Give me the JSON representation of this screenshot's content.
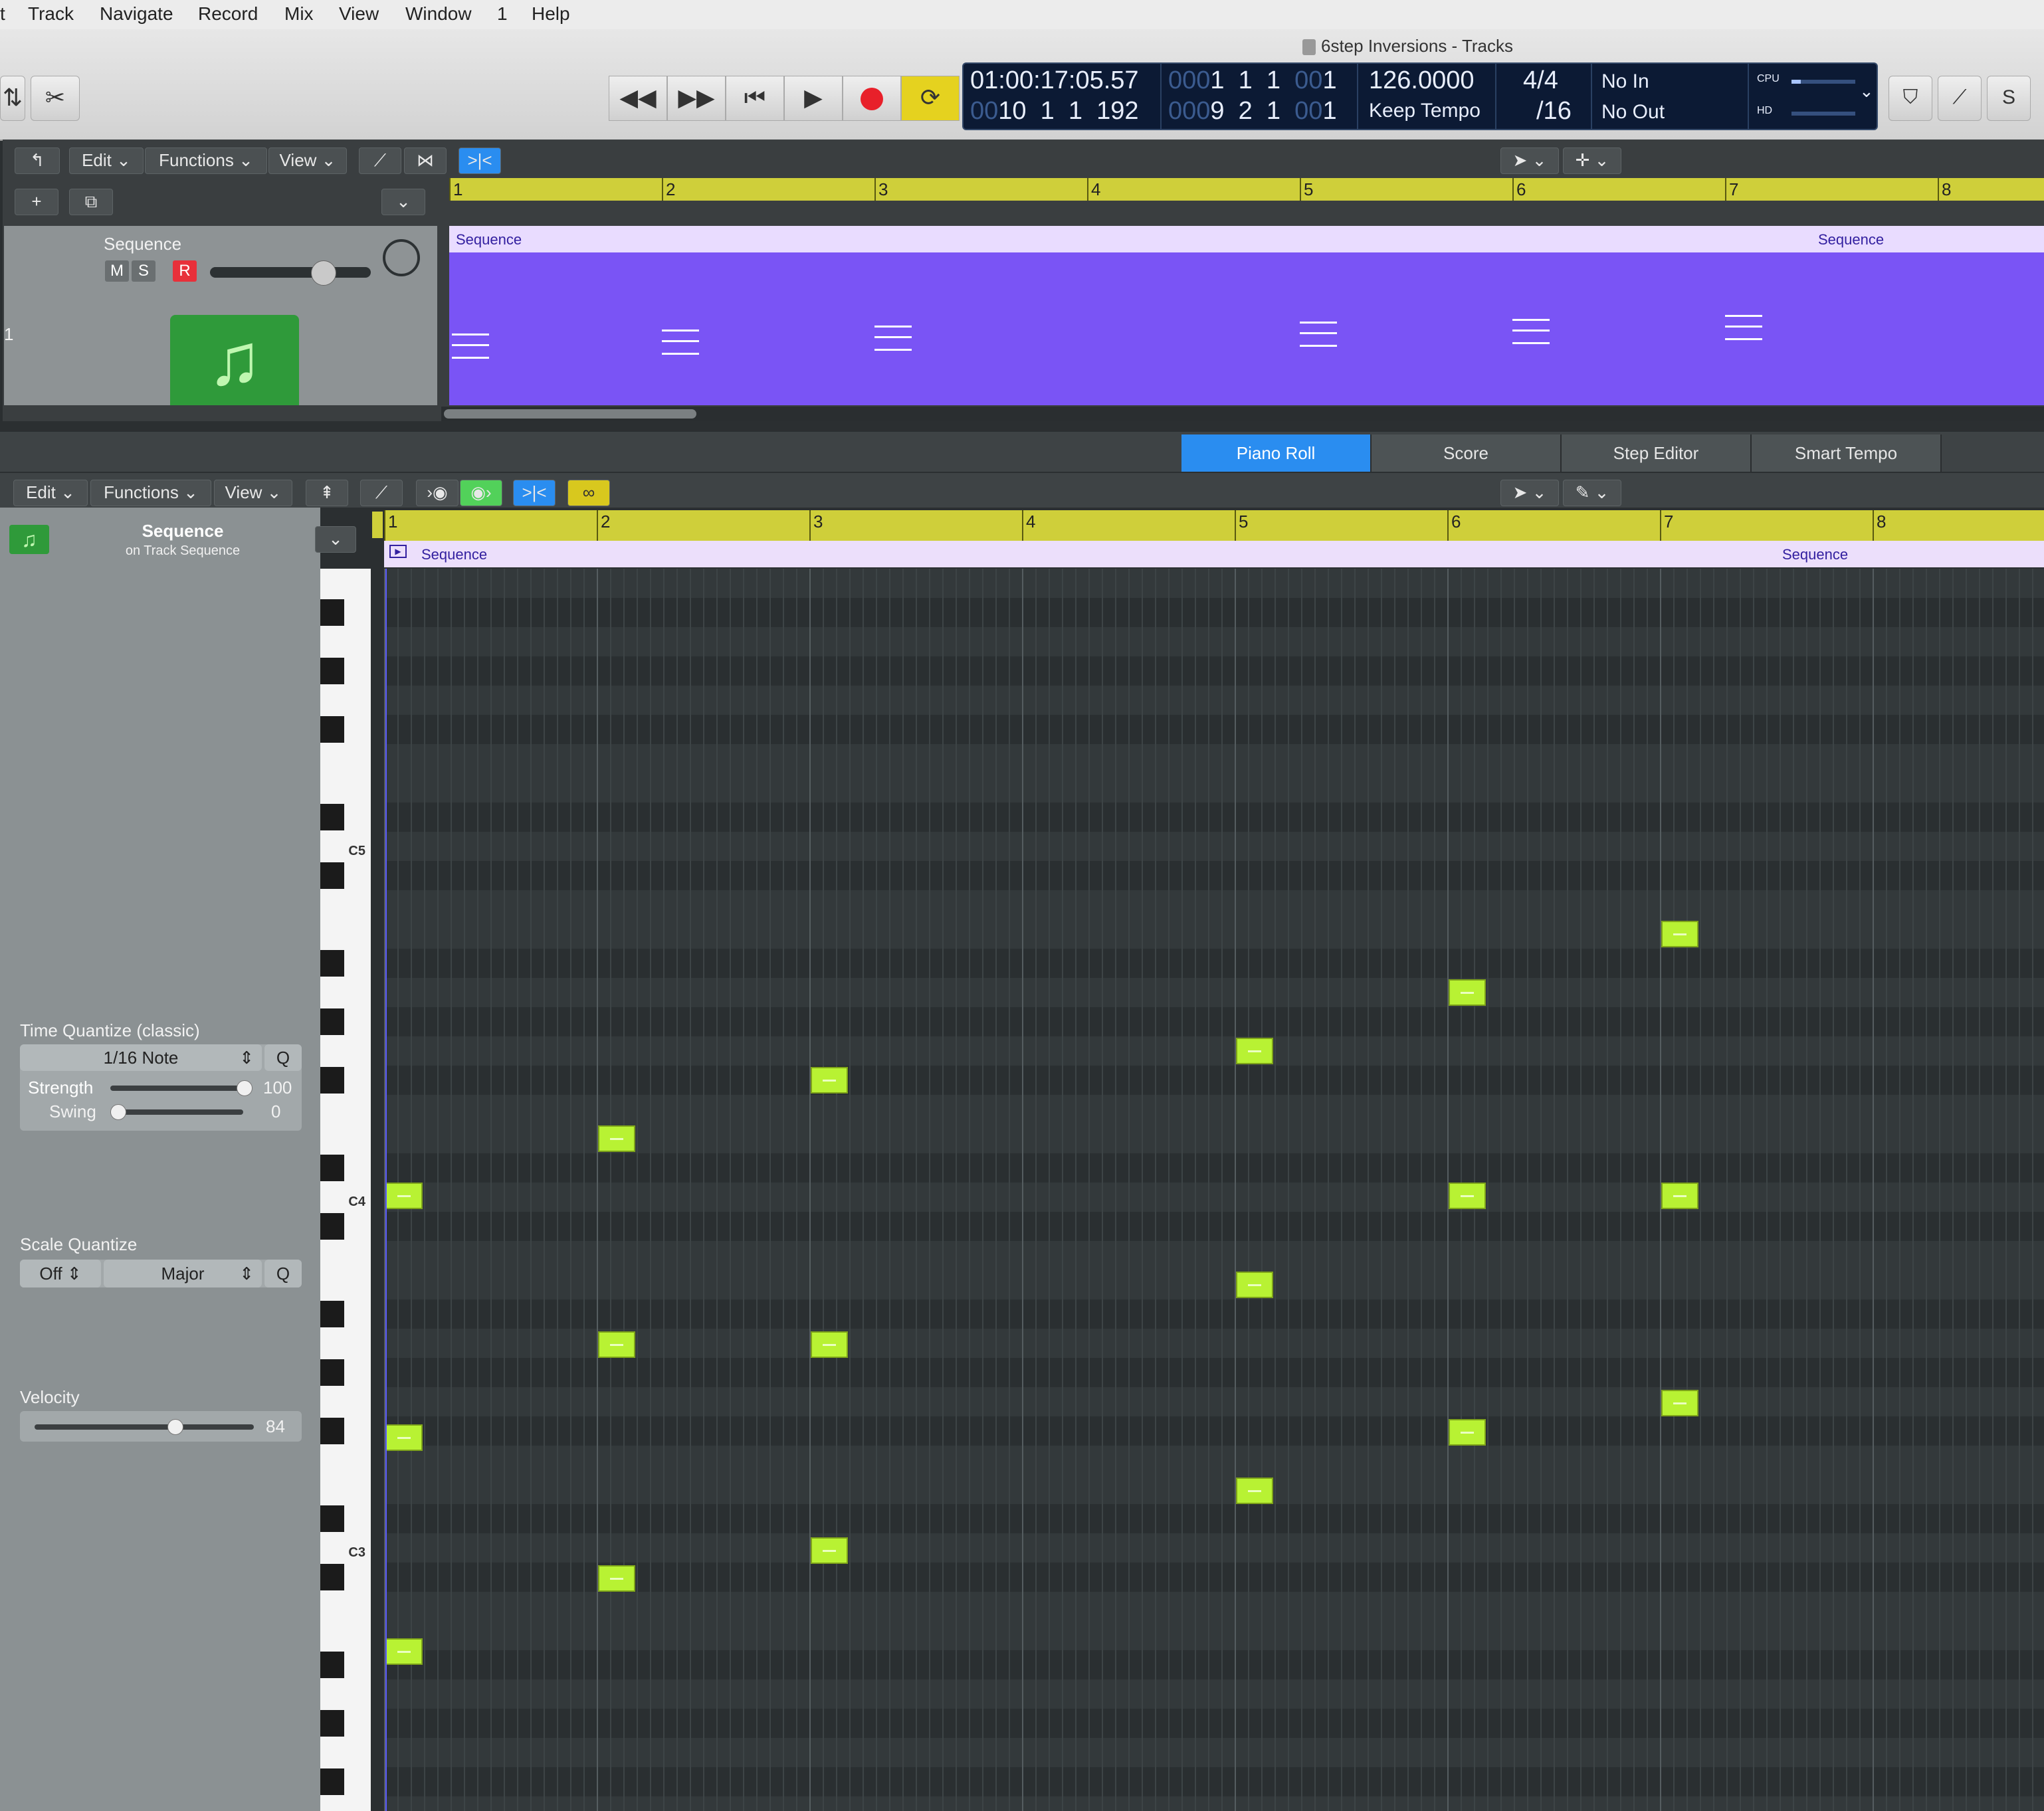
{
  "menu": [
    "t",
    "Track",
    "Navigate",
    "Record",
    "Mix",
    "View",
    "Window",
    "1",
    "Help"
  ],
  "window_title": "6step Inversions - Tracks",
  "lcd": {
    "time": "01:00:17:05.57",
    "pos_dim": "000",
    "pos": "1  1  1",
    "pos_tick_dim": "00",
    "pos_tick": "1",
    "end_dim": "00",
    "end": "10  1  1  192",
    "end2_dim": "000",
    "end2": "9  2  1",
    "end2_tick_dim": "00",
    "end2_tick": "1",
    "tempo": "126.0000",
    "tempo_mode": "Keep Tempo",
    "sig": "4/4",
    "division": "/16",
    "in": "No In",
    "out": "No Out",
    "cpu": "CPU",
    "hd": "HD"
  },
  "tracks_toolbar": {
    "edit": "Edit",
    "functions": "Functions",
    "view": "View"
  },
  "ruler_bars": [
    "1",
    "2",
    "3",
    "4",
    "5",
    "6",
    "7",
    "8"
  ],
  "track": {
    "number": "1",
    "name": "Sequence",
    "m": "M",
    "s": "S",
    "r": "R",
    "region_name": "Sequence"
  },
  "editor_tabs": [
    "Piano Roll",
    "Score",
    "Step Editor",
    "Smart Tempo"
  ],
  "pr_toolbar": {
    "edit": "Edit",
    "functions": "Functions",
    "view": "View"
  },
  "pr_header": {
    "title": "Sequence",
    "subtitle": "on Track Sequence"
  },
  "key_labels": {
    "c5": "C5",
    "c4": "C4",
    "c3": "C3"
  },
  "time_quantize": {
    "title": "Time Quantize (classic)",
    "value": "1/16 Note",
    "q": "Q",
    "strength_label": "Strength",
    "strength": "100",
    "swing_label": "Swing",
    "swing": "0"
  },
  "scale_quantize": {
    "title": "Scale Quantize",
    "value": "Off",
    "scale": "Major",
    "q": "Q"
  },
  "velocity": {
    "title": "Velocity",
    "value": "84"
  },
  "colors": {
    "region": "#7a54f5",
    "note": "#b8f233",
    "ruler": "#cfcf3a",
    "accent": "#2a8df0"
  }
}
